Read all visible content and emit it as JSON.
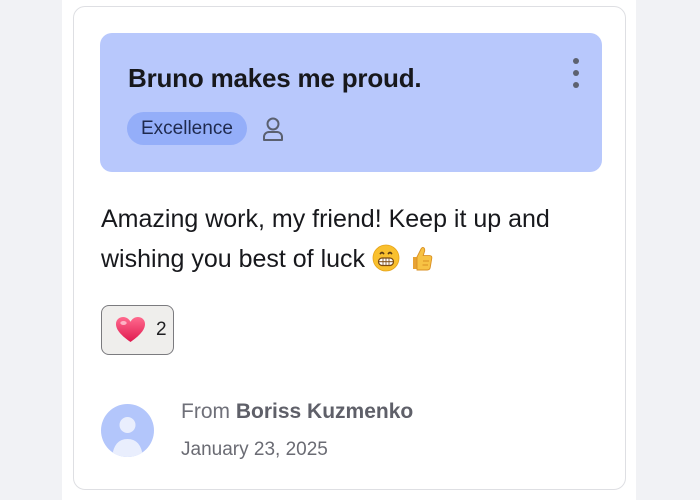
{
  "card": {
    "title": "Bruno makes me proud.",
    "tag": "Excellence",
    "message": "Amazing work, my friend! Keep it up and wishing you best of luck",
    "message_emojis": [
      "grinning-face-icon",
      "thumbs-up-icon"
    ],
    "reaction": {
      "icon": "heart-icon",
      "count": "2"
    },
    "sender": {
      "from_label": "From",
      "name": "Boriss Kuzmenko",
      "date": "January 23, 2025"
    }
  },
  "colors": {
    "header_bg": "#b8c8fc",
    "tag_bg": "#94aef9",
    "avatar_bg": "#b3c6fb",
    "heart": "#ef3b6b"
  }
}
